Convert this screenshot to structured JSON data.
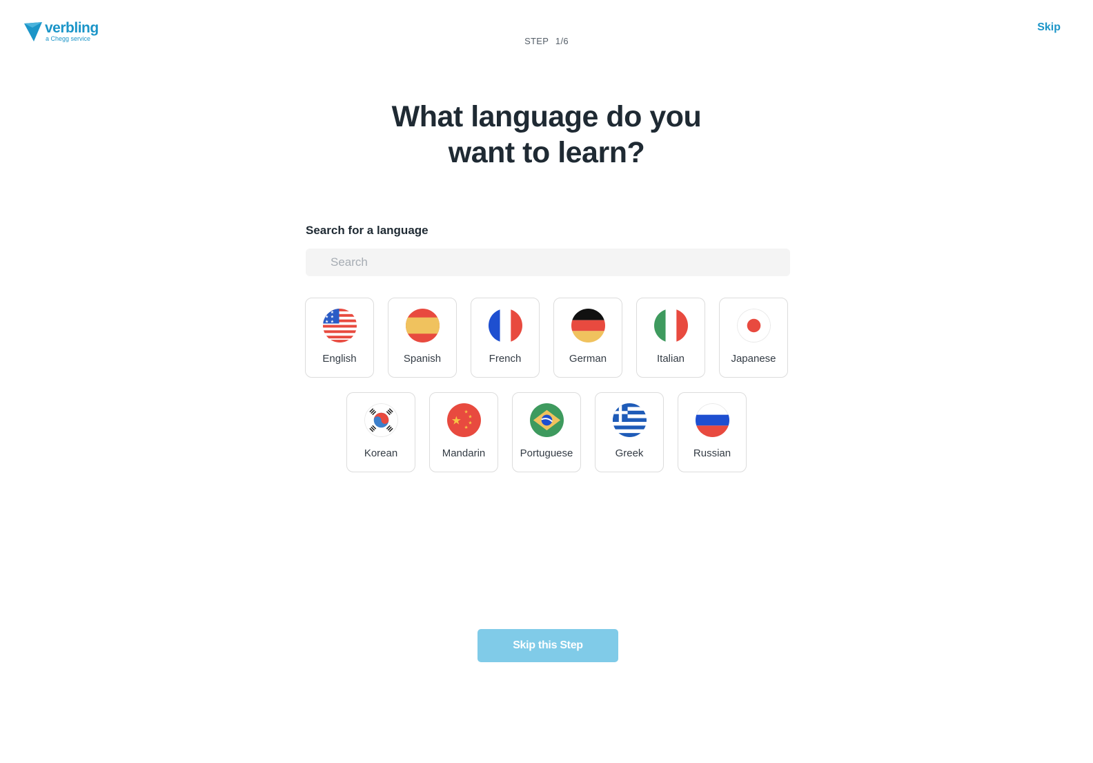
{
  "header": {
    "logo_text": "verbling",
    "logo_subtext": "a Chegg service",
    "step_label": "STEP",
    "step_value": "1/6",
    "skip_label": "Skip"
  },
  "main": {
    "title_line1": "What language do you",
    "title_line2": "want to learn?",
    "search_label": "Search for a language",
    "search_placeholder": "Search",
    "search_value": "",
    "languages_row1": [
      {
        "label": "English",
        "flag": "us-flag-icon"
      },
      {
        "label": "Spanish",
        "flag": "spain-flag-icon"
      },
      {
        "label": "French",
        "flag": "france-flag-icon"
      },
      {
        "label": "German",
        "flag": "germany-flag-icon"
      },
      {
        "label": "Italian",
        "flag": "italy-flag-icon"
      },
      {
        "label": "Japanese",
        "flag": "japan-flag-icon"
      }
    ],
    "languages_row2": [
      {
        "label": "Korean",
        "flag": "korea-flag-icon"
      },
      {
        "label": "Mandarin",
        "flag": "china-flag-icon"
      },
      {
        "label": "Portuguese",
        "flag": "brazil-flag-icon"
      },
      {
        "label": "Greek",
        "flag": "greece-flag-icon"
      },
      {
        "label": "Russian",
        "flag": "russia-flag-icon"
      }
    ],
    "skip_step_label": "Skip this Step"
  },
  "colors": {
    "brand": "#1b95c8",
    "button_bg": "#80cbe8",
    "title": "#1f2a33"
  }
}
